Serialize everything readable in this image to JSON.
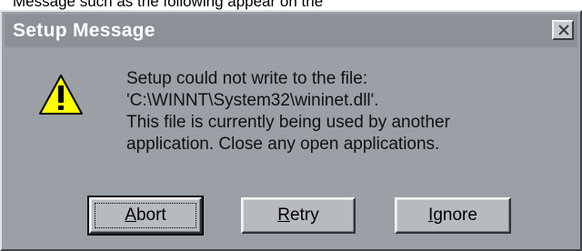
{
  "background_fragment": "Message such as the following appear on the",
  "dialog": {
    "title": "Setup Message",
    "close_icon": "close-icon",
    "icon": "warning-icon",
    "message_lines": [
      "Setup could not write to the file:",
      "'C:\\WINNT\\System32\\wininet.dll'.",
      "This file is currently being used by another",
      "application. Close any open applications."
    ]
  },
  "buttons": {
    "abort": {
      "mnemonic": "A",
      "rest": "bort"
    },
    "retry": {
      "mnemonic": "R",
      "rest": "etry"
    },
    "ignore": {
      "mnemonic": "I",
      "rest": "gnore"
    }
  },
  "colors": {
    "dialog_face": "#9aa0a6",
    "titlebar": "#8c9198",
    "warning_yellow": "#ffff00"
  }
}
